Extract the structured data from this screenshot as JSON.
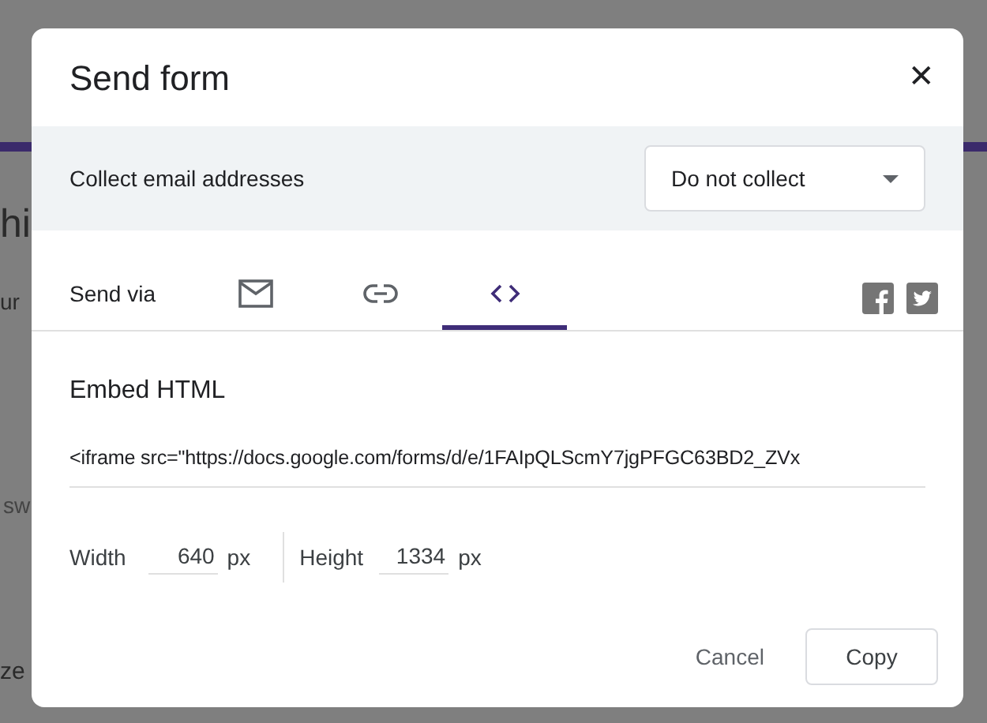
{
  "background": {
    "fragments": [
      "hi",
      "ur",
      "sw",
      "ze"
    ]
  },
  "dialog": {
    "title": "Send form",
    "close": "✕"
  },
  "collect_email": {
    "label": "Collect email addresses",
    "value": "Do not collect"
  },
  "send_via": {
    "label": "Send via",
    "tabs": [
      {
        "kind": "email",
        "selected": false
      },
      {
        "kind": "link",
        "selected": false
      },
      {
        "kind": "embed",
        "selected": true
      }
    ]
  },
  "embed": {
    "heading": "Embed HTML",
    "code": "<iframe src=\"https://docs.google.com/forms/d/e/1FAIpQLScmY7jgPFGC63BD2_ZVx",
    "width": {
      "label": "Width",
      "value": "640",
      "unit": "px"
    },
    "height": {
      "label": "Height",
      "value": "1334",
      "unit": "px"
    }
  },
  "buttons": {
    "cancel": "Cancel",
    "copy": "Copy"
  }
}
